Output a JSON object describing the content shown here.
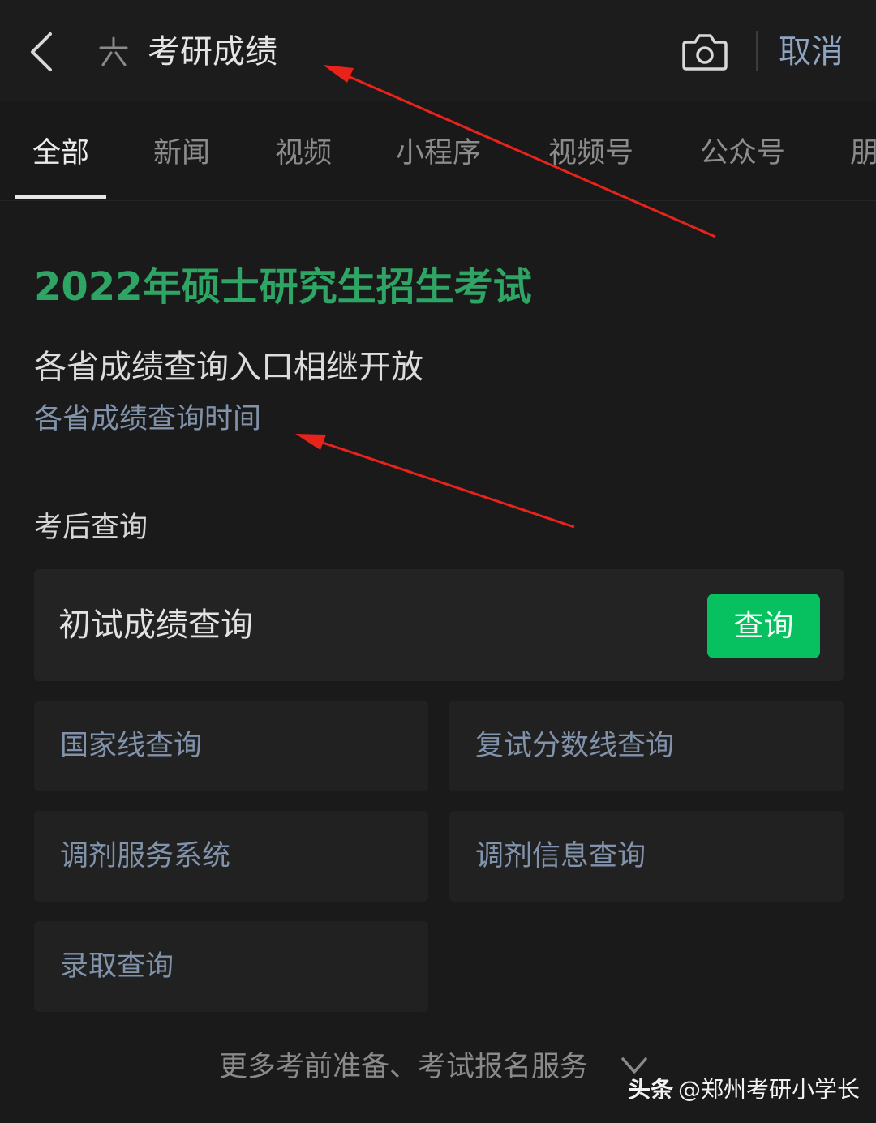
{
  "search_bar": {
    "query": "考研成绩",
    "cancel_label": "取消"
  },
  "tabs": [
    {
      "label": "全部",
      "active": true
    },
    {
      "label": "新闻",
      "active": false
    },
    {
      "label": "视频",
      "active": false
    },
    {
      "label": "小程序",
      "active": false
    },
    {
      "label": "视频号",
      "active": false
    },
    {
      "label": "公众号",
      "active": false
    },
    {
      "label": "朋",
      "active": false
    }
  ],
  "result": {
    "title": "2022年硕士研究生招生考试",
    "subtitle": "各省成绩查询入口相继开放",
    "link": "各省成绩查询时间",
    "section_heading": "考后查询",
    "primary_item": {
      "label": "初试成绩查询",
      "button_label": "查询"
    },
    "grid_items": [
      "国家线查询",
      "复试分数线查询",
      "调剂服务系统",
      "调剂信息查询",
      "录取查询"
    ],
    "more_label": "更多考前准备、考试报名服务"
  },
  "watermark": {
    "brand": "头条",
    "handle": "@郑州考研小学长"
  },
  "colors": {
    "background": "#191919",
    "title_green": "#2ea565",
    "button_green": "#07c160",
    "link_blue_grey": "#8192ab",
    "annotation_red": "#e8231b"
  },
  "icons": {
    "back": "back-icon",
    "search_logo": "search-logo-icon",
    "camera": "camera-icon",
    "chevron": "chevron-down-icon"
  }
}
